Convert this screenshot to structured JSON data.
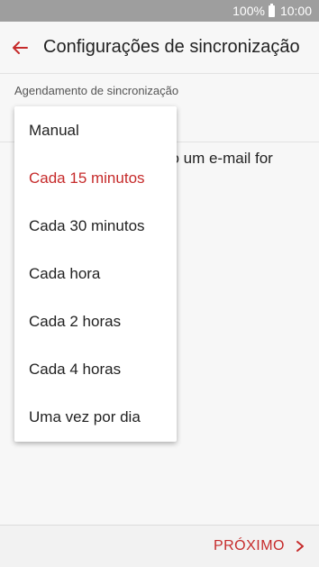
{
  "status_bar": {
    "battery": "100%",
    "time": "10:00"
  },
  "app_bar": {
    "title": "Configurações de sincronização",
    "back_icon": "arrow-left-icon"
  },
  "section": {
    "label": "Agendamento de sincronização"
  },
  "background_text": "do um e-mail for",
  "dropdown": {
    "options": [
      {
        "label": "Manual",
        "selected": false
      },
      {
        "label": "Cada 15 minutos",
        "selected": true
      },
      {
        "label": "Cada 30 minutos",
        "selected": false
      },
      {
        "label": "Cada hora",
        "selected": false
      },
      {
        "label": "Cada 2 horas",
        "selected": false
      },
      {
        "label": "Cada 4 horas",
        "selected": false
      },
      {
        "label": "Uma vez por dia",
        "selected": false
      }
    ]
  },
  "bottom_bar": {
    "next_label": "PRÓXIMO",
    "next_icon": "chevron-right-icon"
  },
  "colors": {
    "accent": "#c62b2b",
    "status_bar": "#9e9e9e",
    "background": "#f7f7f7"
  }
}
